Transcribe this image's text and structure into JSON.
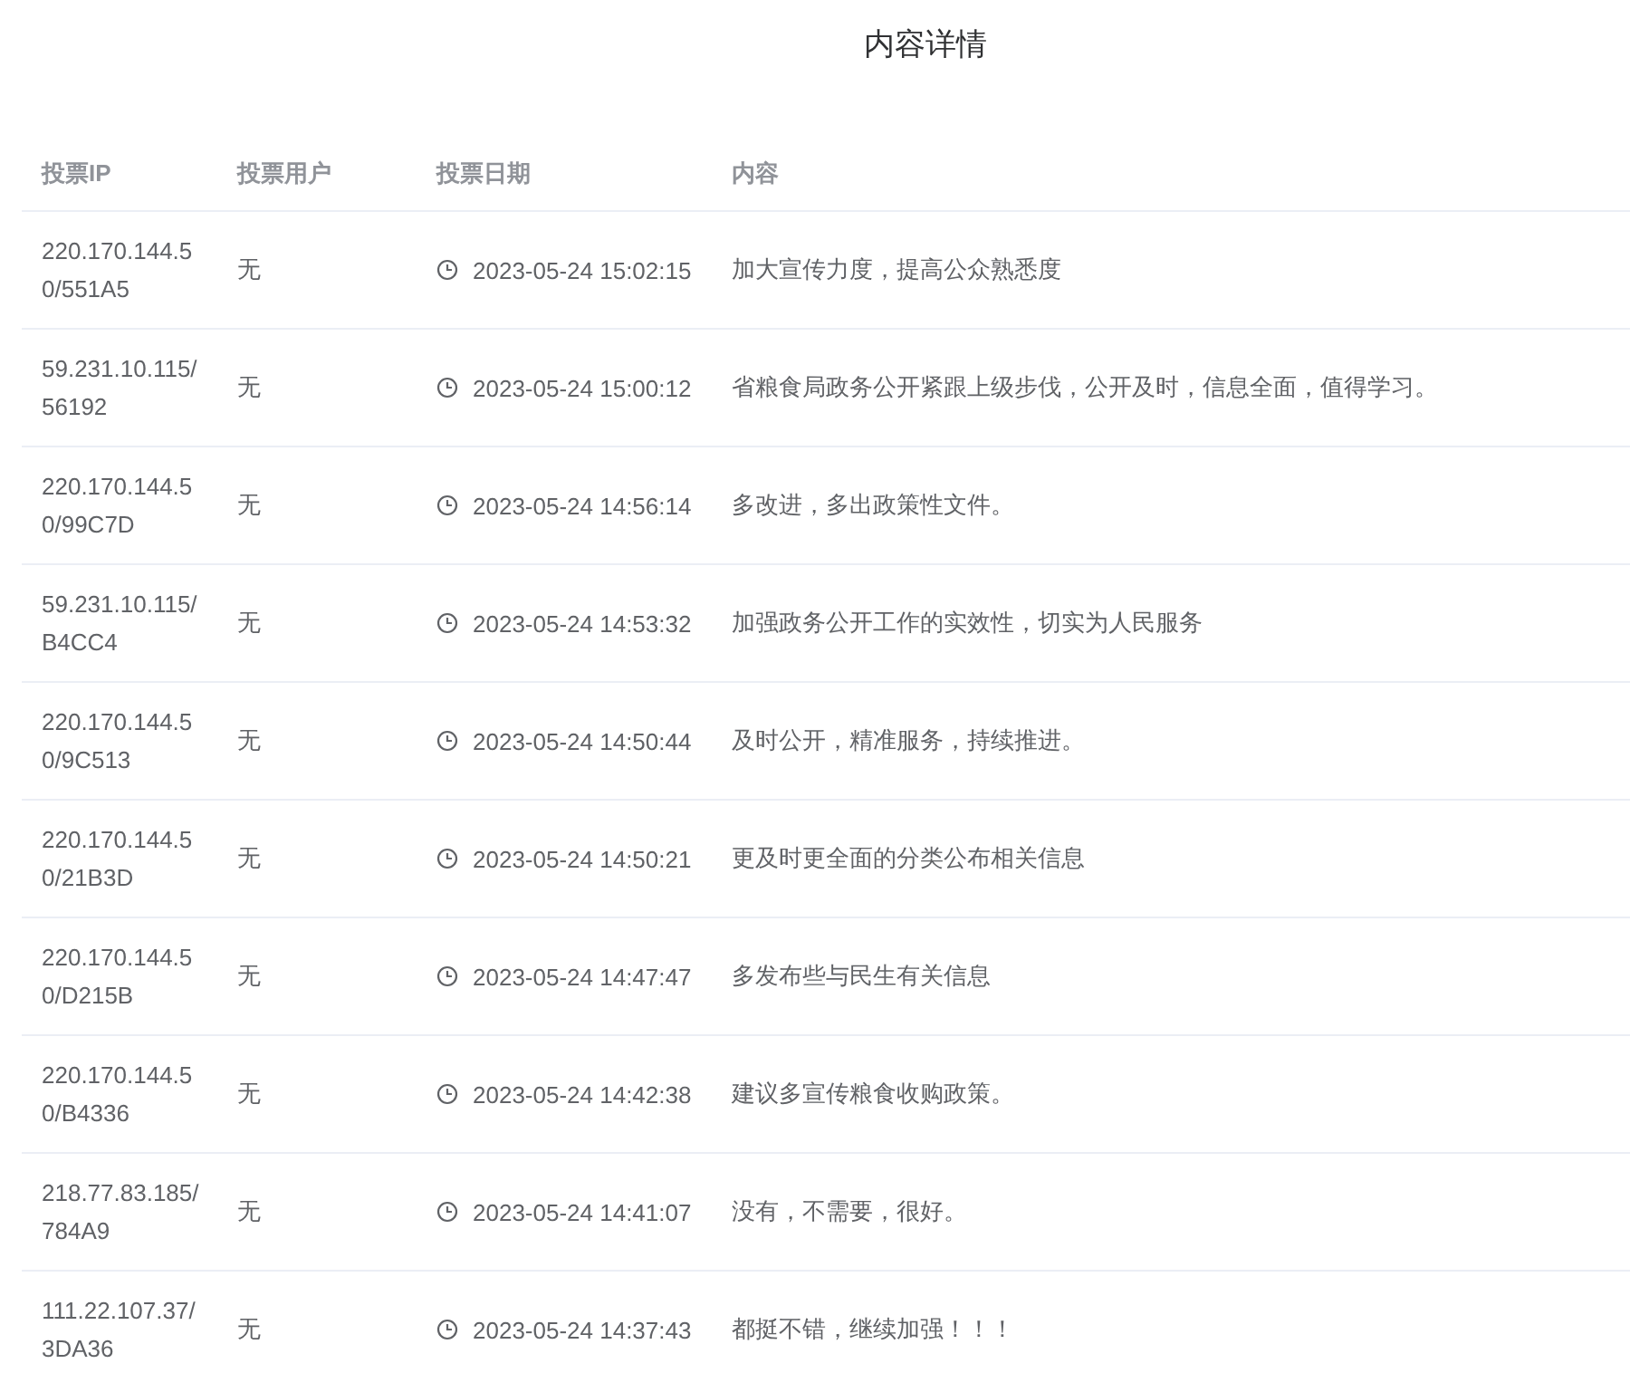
{
  "title": "内容详情",
  "table": {
    "columns": [
      "投票IP",
      "投票用户",
      "投票日期",
      "内容"
    ],
    "rows": [
      {
        "ip": "220.170.144.50/551A5",
        "user": "无",
        "date": "2023-05-24 15:02:15",
        "content": "加大宣传力度，提高公众熟悉度"
      },
      {
        "ip": "59.231.10.115/56192",
        "user": "无",
        "date": "2023-05-24 15:00:12",
        "content": "省粮食局政务公开紧跟上级步伐，公开及时，信息全面，值得学习。"
      },
      {
        "ip": "220.170.144.50/99C7D",
        "user": "无",
        "date": "2023-05-24 14:56:14",
        "content": "多改进，多出政策性文件。"
      },
      {
        "ip": "59.231.10.115/B4CC4",
        "user": "无",
        "date": "2023-05-24 14:53:32",
        "content": "加强政务公开工作的实效性，切实为人民服务"
      },
      {
        "ip": "220.170.144.50/9C513",
        "user": "无",
        "date": "2023-05-24 14:50:44",
        "content": "及时公开，精准服务，持续推进。"
      },
      {
        "ip": "220.170.144.50/21B3D",
        "user": "无",
        "date": "2023-05-24 14:50:21",
        "content": "更及时更全面的分类公布相关信息"
      },
      {
        "ip": "220.170.144.50/D215B",
        "user": "无",
        "date": "2023-05-24 14:47:47",
        "content": "多发布些与民生有关信息"
      },
      {
        "ip": "220.170.144.50/B4336",
        "user": "无",
        "date": "2023-05-24 14:42:38",
        "content": "建议多宣传粮食收购政策。"
      },
      {
        "ip": "218.77.83.185/784A9",
        "user": "无",
        "date": "2023-05-24 14:41:07",
        "content": "没有，不需要，很好。"
      },
      {
        "ip": "111.22.107.37/3DA36",
        "user": "无",
        "date": "2023-05-24 14:37:43",
        "content": "都挺不错，继续加强！！！"
      }
    ]
  }
}
